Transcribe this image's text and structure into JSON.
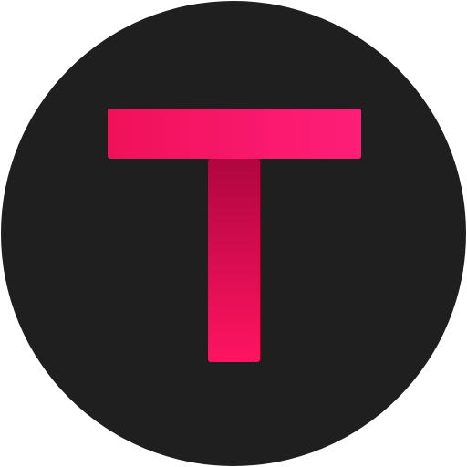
{
  "logo": {
    "letter": "T",
    "icon": "letter-t-logo-icon",
    "colors": {
      "circle_background": "#1f1f1f",
      "crossbar_left": "#f0115a",
      "crossbar_right": "#ff1e78",
      "stem_top": "#b0063f",
      "stem_bottom": "#ff1462"
    }
  }
}
